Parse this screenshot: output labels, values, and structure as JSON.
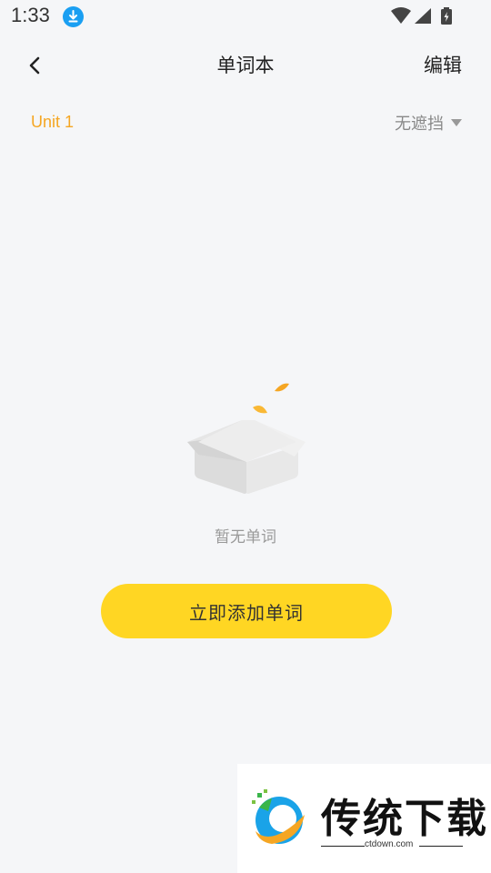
{
  "status_bar": {
    "time": "1:33",
    "icons": [
      "download-icon",
      "wifi-icon",
      "signal-icon",
      "battery-charging-icon"
    ]
  },
  "nav": {
    "title": "单词本",
    "edit_label": "编辑",
    "back_icon": "chevron-left-icon"
  },
  "filter": {
    "unit_label": "Unit 1",
    "mask_label": "无遮挡",
    "mask_icon": "caret-down-icon"
  },
  "empty_state": {
    "icon": "empty-box-icon",
    "text": "暂无单词"
  },
  "add_button": {
    "label": "立即添加单词"
  },
  "watermark": {
    "title": "传统下载",
    "url": "ctdown.com"
  },
  "colors": {
    "background": "#f5f6f8",
    "accent_orange": "#f5a623",
    "button_yellow": "#ffd623",
    "download_badge": "#1a9ff2"
  }
}
